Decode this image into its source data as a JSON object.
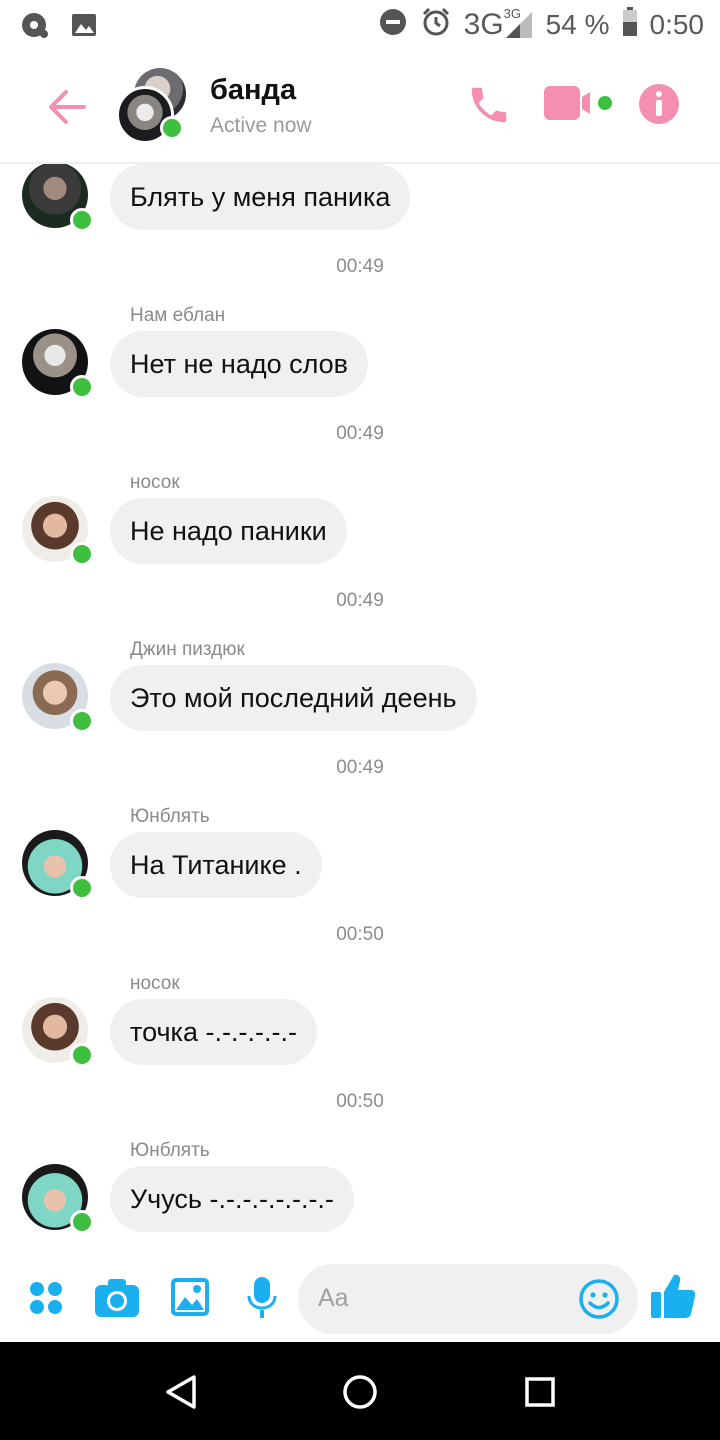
{
  "status_bar": {
    "network": "3G",
    "network_small": "3G",
    "battery": "54 %",
    "time": "0:50"
  },
  "header": {
    "title": "банда",
    "subtitle": "Active now",
    "accent_color": "#f48fb1"
  },
  "messages": [
    {
      "sender": "",
      "text": "Блять у меня паника",
      "time": "00:49",
      "avatar": "avatar-1"
    },
    {
      "sender": "Нам еблан",
      "text": "Нет не надо слов",
      "time": "00:49",
      "avatar": "avatar-2"
    },
    {
      "sender": "носок",
      "text": "Не надо паники",
      "time": "00:49",
      "avatar": "avatar-3"
    },
    {
      "sender": "Джин пиздюк",
      "text": "Это мой последний деень",
      "time": "00:49",
      "avatar": "avatar-4"
    },
    {
      "sender": "Юнблять",
      "text": "На Титанике .",
      "time": "00:50",
      "avatar": "avatar-5"
    },
    {
      "sender": "носок",
      "text": "точка -.-.-.-.-.-",
      "time": "00:50",
      "avatar": "avatar-3"
    },
    {
      "sender": "Юнблять",
      "text": "Учусь -.-.-.-.-.-.-.-",
      "time": "",
      "avatar": "avatar-5"
    }
  ],
  "composer": {
    "placeholder": "Aa",
    "icon_color": "#1ab0f0"
  }
}
